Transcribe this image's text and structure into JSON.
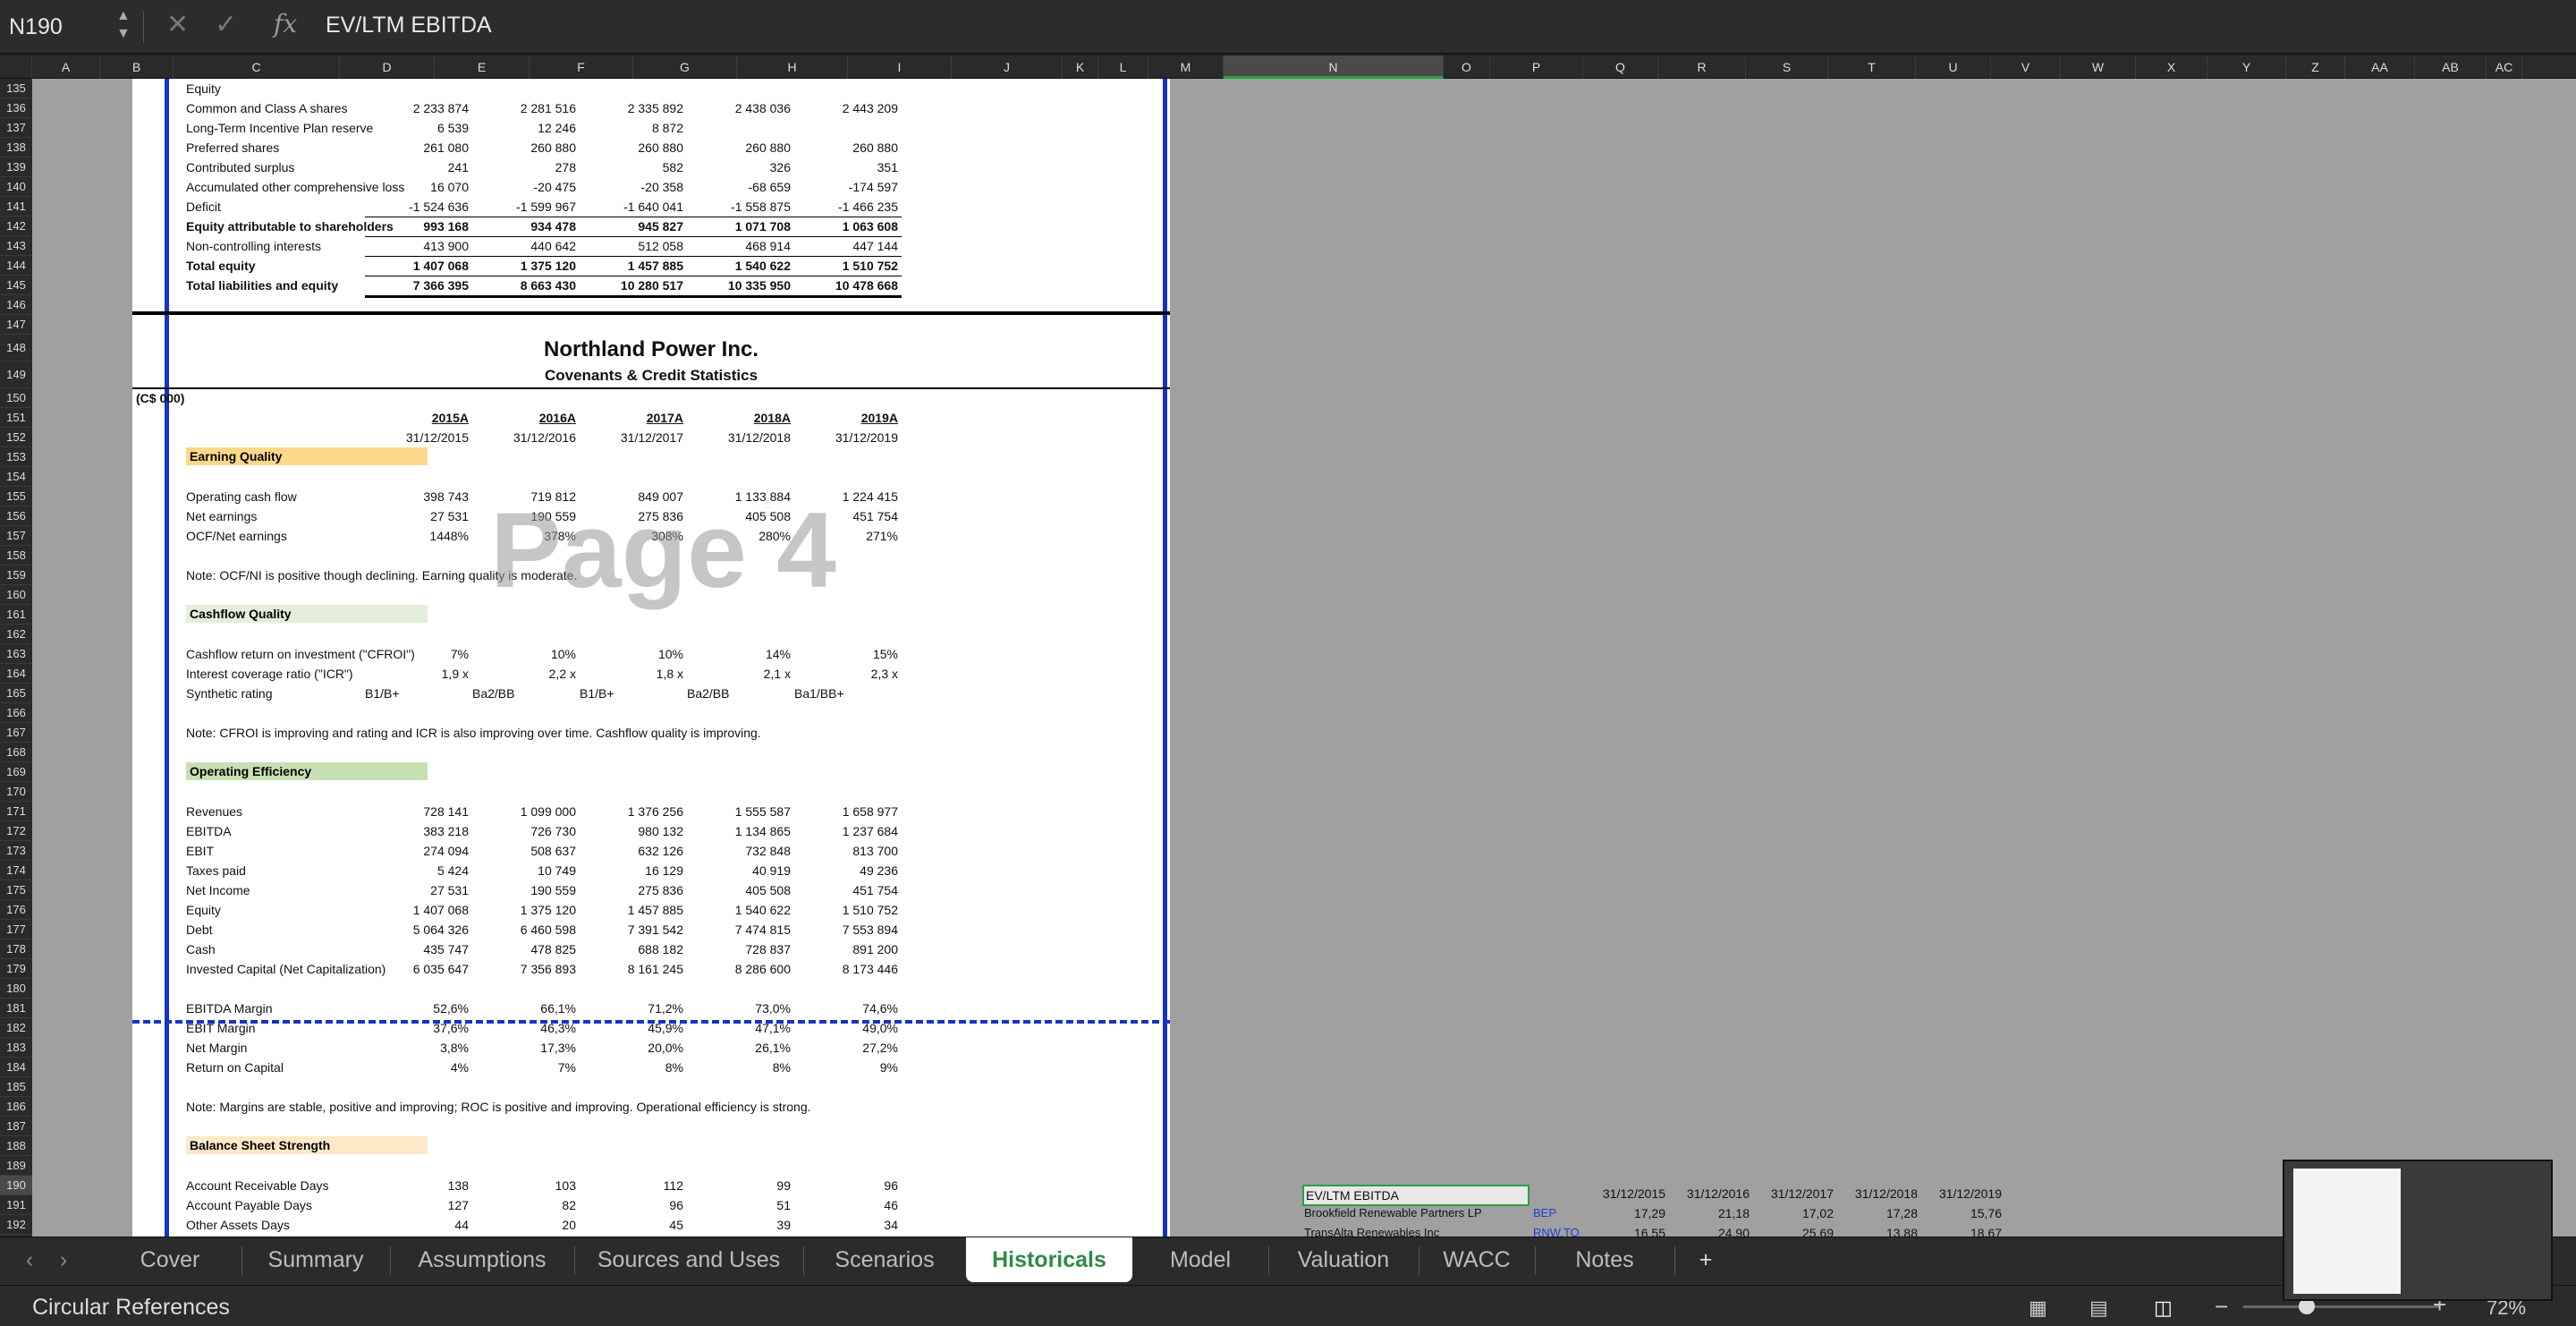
{
  "formula_bar": {
    "cell_ref": "N190",
    "formula": "EV/LTM EBITDA"
  },
  "columns": [
    "A",
    "B",
    "C",
    "D",
    "E",
    "F",
    "G",
    "H",
    "I",
    "J",
    "K",
    "L",
    "M",
    "N",
    "O",
    "P",
    "Q",
    "R",
    "S",
    "T",
    "U",
    "V",
    "W",
    "X",
    "Y",
    "Z",
    "AA",
    "AB",
    "AC"
  ],
  "outline": [
    "1",
    "2"
  ],
  "rows_top": [
    "135",
    "136",
    "137",
    "138",
    "139",
    "140",
    "141",
    "142",
    "143",
    "144",
    "145",
    "146",
    "147"
  ],
  "equity_rows": [
    {
      "label": "Equity",
      "vals": [
        "",
        "",
        "",
        "",
        ""
      ],
      "bold": false
    },
    {
      "label": "Common and Class A shares",
      "vals": [
        "2 233 874",
        "2 281 516",
        "2 335 892",
        "2 438 036",
        "2 443 209"
      ]
    },
    {
      "label": "Long-Term Incentive Plan reserve",
      "vals": [
        "6 539",
        "12 246",
        "8 872",
        "",
        ""
      ]
    },
    {
      "label": "Preferred shares",
      "vals": [
        "261 080",
        "260 880",
        "260 880",
        "260 880",
        "260 880"
      ]
    },
    {
      "label": "Contributed surplus",
      "vals": [
        "241",
        "278",
        "582",
        "326",
        "351"
      ]
    },
    {
      "label": "Accumulated other comprehensive loss",
      "vals": [
        "16 070",
        "-20 475",
        "-20 358",
        "-68 659",
        "-174 597"
      ]
    },
    {
      "label": "Deficit",
      "vals": [
        "-1 524 636",
        "-1 599 967",
        "-1 640 041",
        "-1 558 875",
        "-1 466 235"
      ]
    },
    {
      "label": "Equity attributable to shareholders",
      "vals": [
        "993 168",
        "934 478",
        "945 827",
        "1 071 708",
        "1 063 608"
      ],
      "bold": true
    },
    {
      "label": "Non-controlling interests",
      "vals": [
        "413 900",
        "440 642",
        "512 058",
        "468 914",
        "447 144"
      ]
    },
    {
      "label": "Total equity",
      "vals": [
        "1 407 068",
        "1 375 120",
        "1 457 885",
        "1 540 622",
        "1 510 752"
      ],
      "bold": true
    },
    {
      "label": "Total liabilities and equity",
      "vals": [
        "7 366 395",
        "8 663 430",
        "10 280 517",
        "10 335 950",
        "10 478 668"
      ],
      "bold": true
    }
  ],
  "company": "Northland Power Inc.",
  "subtitle": "Covenants & Credit Statistics",
  "units": "(C$ 000)",
  "years": [
    "2015A",
    "2016A",
    "2017A",
    "2018A",
    "2019A"
  ],
  "dates": [
    "31/12/2015",
    "31/12/2016",
    "31/12/2017",
    "31/12/2018",
    "31/12/2019"
  ],
  "watermark": "Page 4",
  "sections": {
    "earning": {
      "title": "Earning Quality",
      "color": "#fcd98a",
      "rows": [
        {
          "label": "Operating cash flow",
          "vals": [
            "398 743",
            "719 812",
            "849 007",
            "1 133 884",
            "1 224 415"
          ]
        },
        {
          "label": "Net earnings",
          "vals": [
            "27 531",
            "190 559",
            "275 836",
            "405 508",
            "451 754"
          ]
        },
        {
          "label": "OCF/Net earnings",
          "vals": [
            "1448%",
            "378%",
            "308%",
            "280%",
            "271%"
          ]
        }
      ],
      "note": "Note: OCF/NI is positive though declining. Earning quality is moderate."
    },
    "cashflow": {
      "title": "Cashflow Quality",
      "color": "#e3efd9",
      "rows": [
        {
          "label": "Cashflow return on investment (\"CFROI\")",
          "vals": [
            "7%",
            "10%",
            "10%",
            "14%",
            "15%"
          ]
        },
        {
          "label": "Interest coverage ratio (\"ICR\")",
          "vals": [
            "1,9 x",
            "2,2 x",
            "1,8 x",
            "2,1 x",
            "2,3 x"
          ]
        }
      ],
      "rating_label": "Synthetic rating",
      "ratings": [
        "B1/B+",
        "Ba2/BB",
        "B1/B+",
        "Ba2/BB",
        "Ba1/BB+"
      ],
      "note": "Note: CFROI is improving and rating and ICR is also improving over time. Cashflow quality is improving."
    },
    "operating": {
      "title": "Operating Efficiency",
      "color": "#c6e0b4",
      "rows": [
        {
          "label": "Revenues",
          "vals": [
            "728 141",
            "1 099 000",
            "1 376 256",
            "1 555 587",
            "1 658 977"
          ]
        },
        {
          "label": "EBITDA",
          "vals": [
            "383 218",
            "726 730",
            "980 132",
            "1 134 865",
            "1 237 684"
          ]
        },
        {
          "label": "EBIT",
          "vals": [
            "274 094",
            "508 637",
            "632 126",
            "732 848",
            "813 700"
          ]
        },
        {
          "label": "Taxes paid",
          "vals": [
            "5 424",
            "10 749",
            "16 129",
            "40 919",
            "49 236"
          ]
        },
        {
          "label": "Net Income",
          "vals": [
            "27 531",
            "190 559",
            "275 836",
            "405 508",
            "451 754"
          ]
        },
        {
          "label": "Equity",
          "vals": [
            "1 407 068",
            "1 375 120",
            "1 457 885",
            "1 540 622",
            "1 510 752"
          ]
        },
        {
          "label": "Debt",
          "vals": [
            "5 064 326",
            "6 460 598",
            "7 391 542",
            "7 474 815",
            "7 553 894"
          ]
        },
        {
          "label": "Cash",
          "vals": [
            "435 747",
            "478 825",
            "688 182",
            "728 837",
            "891 200"
          ]
        },
        {
          "label": "Invested Capital (Net Capitalization)",
          "vals": [
            "6 035 647",
            "7 356 893",
            "8 161 245",
            "8 286 600",
            "8 173 446"
          ]
        }
      ],
      "margins": [
        {
          "label": "EBITDA Margin",
          "vals": [
            "52,6%",
            "66,1%",
            "71,2%",
            "73,0%",
            "74,6%"
          ]
        },
        {
          "label": "EBIT Margin",
          "vals": [
            "37,6%",
            "46,3%",
            "45,9%",
            "47,1%",
            "49,0%"
          ]
        },
        {
          "label": "Net Margin",
          "vals": [
            "3,8%",
            "17,3%",
            "20,0%",
            "26,1%",
            "27,2%"
          ]
        },
        {
          "label": "Return on Capital",
          "vals": [
            "4%",
            "7%",
            "8%",
            "8%",
            "9%"
          ]
        }
      ],
      "note": "Note: Margins are stable, positive and improving; ROC is positive and improving. Operational efficiency is strong."
    },
    "balance": {
      "title": "Balance Sheet Strength",
      "color": "#fde9c8",
      "rows": [
        {
          "label": "Account Receivable Days",
          "vals": [
            "138",
            "103",
            "112",
            "99",
            "96"
          ]
        },
        {
          "label": "Account Payable Days",
          "vals": [
            "127",
            "82",
            "96",
            "51",
            "46"
          ]
        },
        {
          "label": "Other Assets Days",
          "vals": [
            "44",
            "20",
            "45",
            "39",
            "34"
          ]
        }
      ]
    }
  },
  "right_table": {
    "header": "EV/LTM EBITDA",
    "dates": [
      "31/12/2015",
      "31/12/2016",
      "31/12/2017",
      "31/12/2018",
      "31/12/2019"
    ],
    "rows": [
      {
        "name": "Brookfield Renewable Partners LP",
        "ticker": "BEP",
        "vals": [
          "17,29",
          "21,18",
          "17,02",
          "17,28",
          "15,76"
        ]
      },
      {
        "name": "TransAlta Renewables Inc",
        "ticker": "RNW.TO",
        "vals": [
          "16,55",
          "24,90",
          "25,69",
          "13,88",
          "18,67"
        ]
      }
    ]
  },
  "tabs": [
    "Cover",
    "Summary",
    "Assumptions",
    "Sources and Uses",
    "Scenarios",
    "Historicals",
    "Model",
    "Valuation",
    "WACC",
    "Notes"
  ],
  "active_tab": "Historicals",
  "add_tab": "+",
  "status": "Circular References",
  "zoom": "72%"
}
